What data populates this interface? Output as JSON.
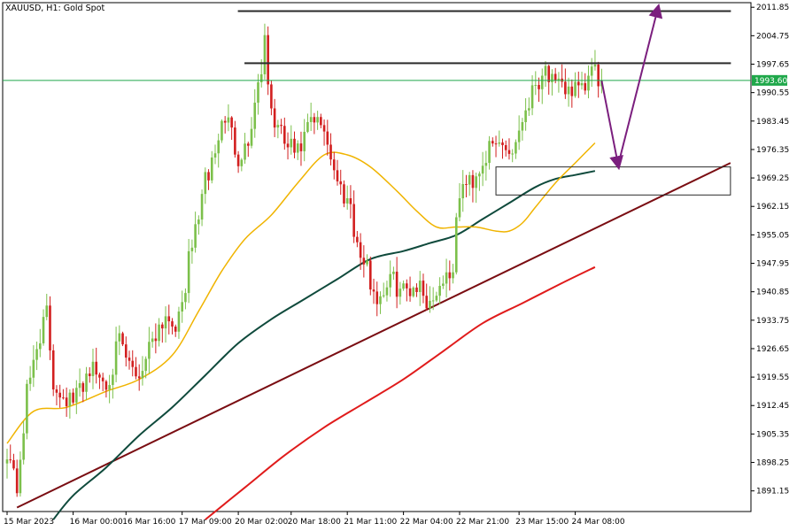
{
  "chart_data": {
    "type": "candlestick",
    "title": "XAUUSD, H1:  Gold Spot",
    "ylim": [
      1886,
      2013
    ],
    "y_ticks": [
      2011.85,
      2004.75,
      1997.65,
      1990.55,
      1983.45,
      1976.35,
      1969.25,
      1962.15,
      1955.05,
      1947.95,
      1940.85,
      1933.75,
      1926.65,
      1919.55,
      1912.45,
      1905.35,
      1898.25,
      1891.15
    ],
    "x_ticks": [
      {
        "label": "15 Mar 2023",
        "i": 0
      },
      {
        "label": "16 Mar 00:00",
        "i": 20
      },
      {
        "label": "16 Mar 16:00",
        "i": 36
      },
      {
        "label": "17 Mar 09:00",
        "i": 53
      },
      {
        "label": "20 Mar 02:00",
        "i": 70
      },
      {
        "label": "20 Mar 18:00",
        "i": 86
      },
      {
        "label": "21 Mar 11:00",
        "i": 103
      },
      {
        "label": "22 Mar 04:00",
        "i": 120
      },
      {
        "label": "22 Mar 21:00",
        "i": 137
      },
      {
        "label": "23 Mar 15:00",
        "i": 155
      },
      {
        "label": "24 Mar 08:00",
        "i": 172
      }
    ],
    "current_price": {
      "value": 1993.6,
      "label": "1993.60",
      "color": "#1fa84a"
    },
    "colors": {
      "bull": "#7cc04b",
      "bear": "#d21f1f",
      "ma_fast": "#f0b400",
      "ma_mid": "#0f4a3c",
      "ma_slow": "#e01b1b",
      "trendline": "#7a0d12",
      "arrow": "#7b1f7e",
      "box": "#2a2a2a",
      "grid": "#000000"
    },
    "pivots": [
      [
        0,
        1902.0
      ],
      [
        3,
        1892.0
      ],
      [
        6,
        1915.0
      ],
      [
        9,
        1928.0
      ],
      [
        12,
        1935.0
      ],
      [
        14,
        1918.0
      ],
      [
        20,
        1913.0
      ],
      [
        25,
        1922.0
      ],
      [
        30,
        1918.0
      ],
      [
        34,
        1928.0
      ],
      [
        37,
        1922.0
      ],
      [
        40,
        1920.0
      ],
      [
        44,
        1930.0
      ],
      [
        48,
        1935.0
      ],
      [
        52,
        1933.0
      ],
      [
        55,
        1948.0
      ],
      [
        59,
        1965.0
      ],
      [
        63,
        1976.0
      ],
      [
        66,
        1985.0
      ],
      [
        70,
        1975.0
      ],
      [
        73,
        1978.0
      ],
      [
        76,
        1993.0
      ],
      [
        78,
        2002.0
      ],
      [
        80,
        1985.0
      ],
      [
        84,
        1978.0
      ],
      [
        88,
        1975.0
      ],
      [
        92,
        1983.0
      ],
      [
        96,
        1982.0
      ],
      [
        100,
        1968.0
      ],
      [
        104,
        1963.0
      ],
      [
        106,
        1952.0
      ],
      [
        109,
        1946.0
      ],
      [
        112,
        1939.0
      ],
      [
        116,
        1944.0
      ],
      [
        120,
        1941.0
      ],
      [
        124,
        1943.0
      ],
      [
        128,
        1938.0
      ],
      [
        131,
        1943.0
      ],
      [
        135,
        1947.0
      ],
      [
        137,
        1966.0
      ],
      [
        141,
        1969.0
      ],
      [
        145,
        1975.0
      ],
      [
        149,
        1978.0
      ],
      [
        153,
        1976.0
      ],
      [
        157,
        1987.0
      ],
      [
        160,
        1993.0
      ],
      [
        163,
        1997.0
      ],
      [
        166,
        1991.0
      ],
      [
        170,
        1992.0
      ],
      [
        174,
        1990.0
      ],
      [
        177,
        1996.0
      ],
      [
        180,
        1993.6
      ]
    ],
    "ma_fast": [
      [
        0,
        1903
      ],
      [
        8,
        1911
      ],
      [
        18,
        1912
      ],
      [
        30,
        1916
      ],
      [
        40,
        1919
      ],
      [
        50,
        1925
      ],
      [
        58,
        1936
      ],
      [
        65,
        1946
      ],
      [
        72,
        1954
      ],
      [
        80,
        1960
      ],
      [
        88,
        1968
      ],
      [
        96,
        1975
      ],
      [
        103,
        1975
      ],
      [
        110,
        1972
      ],
      [
        118,
        1966
      ],
      [
        124,
        1961
      ],
      [
        130,
        1957
      ],
      [
        136,
        1957
      ],
      [
        142,
        1957
      ],
      [
        148,
        1956
      ],
      [
        152,
        1956
      ],
      [
        156,
        1958
      ],
      [
        160,
        1962
      ],
      [
        166,
        1968
      ],
      [
        172,
        1973
      ],
      [
        178,
        1978
      ]
    ],
    "ma_mid": [
      [
        14,
        1884
      ],
      [
        20,
        1890
      ],
      [
        30,
        1897
      ],
      [
        40,
        1905
      ],
      [
        50,
        1912
      ],
      [
        60,
        1920
      ],
      [
        70,
        1928
      ],
      [
        80,
        1934
      ],
      [
        90,
        1939
      ],
      [
        100,
        1944
      ],
      [
        110,
        1949
      ],
      [
        120,
        1951
      ],
      [
        128,
        1953
      ],
      [
        136,
        1955
      ],
      [
        144,
        1959
      ],
      [
        152,
        1963
      ],
      [
        160,
        1967
      ],
      [
        166,
        1969
      ],
      [
        172,
        1970
      ],
      [
        178,
        1971
      ]
    ],
    "ma_slow": [
      [
        60,
        1884
      ],
      [
        72,
        1892
      ],
      [
        84,
        1900
      ],
      [
        96,
        1907
      ],
      [
        108,
        1913
      ],
      [
        120,
        1919
      ],
      [
        132,
        1926
      ],
      [
        144,
        1933
      ],
      [
        156,
        1938
      ],
      [
        168,
        1943
      ],
      [
        178,
        1947
      ]
    ],
    "trendline": [
      [
        3,
        1887.0
      ],
      [
        219,
        1973.0
      ]
    ],
    "rectangles": [
      {
        "x1": 70,
        "x2": 219,
        "y1": 2011.0,
        "y2": 2011.0
      },
      {
        "x1": 72,
        "x2": 219,
        "y1": 1998.0,
        "y2": 1998.0
      },
      {
        "x1": 148,
        "x2": 219,
        "y1": 1972.0,
        "y2": 1965.0
      }
    ],
    "arrow": [
      [
        180,
        1993.5
      ],
      [
        185,
        1972.5
      ],
      [
        197,
        2011.5
      ]
    ]
  }
}
